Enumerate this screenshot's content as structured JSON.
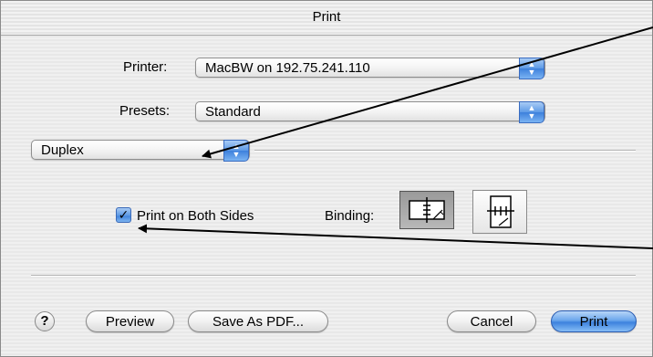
{
  "window": {
    "title": "Print"
  },
  "printer": {
    "label": "Printer:",
    "value": "MacBW on 192.75.241.110"
  },
  "presets": {
    "label": "Presets:",
    "value": "Standard"
  },
  "panel": {
    "value": "Duplex"
  },
  "duplex": {
    "print_both_sides_label": "Print on Both Sides",
    "print_both_sides_checked": true,
    "binding_label": "Binding:"
  },
  "buttons": {
    "help": "?",
    "preview": "Preview",
    "save_pdf": "Save As PDF...",
    "cancel": "Cancel",
    "print": "Print"
  },
  "colors": {
    "accent": "#4a8ee6"
  }
}
